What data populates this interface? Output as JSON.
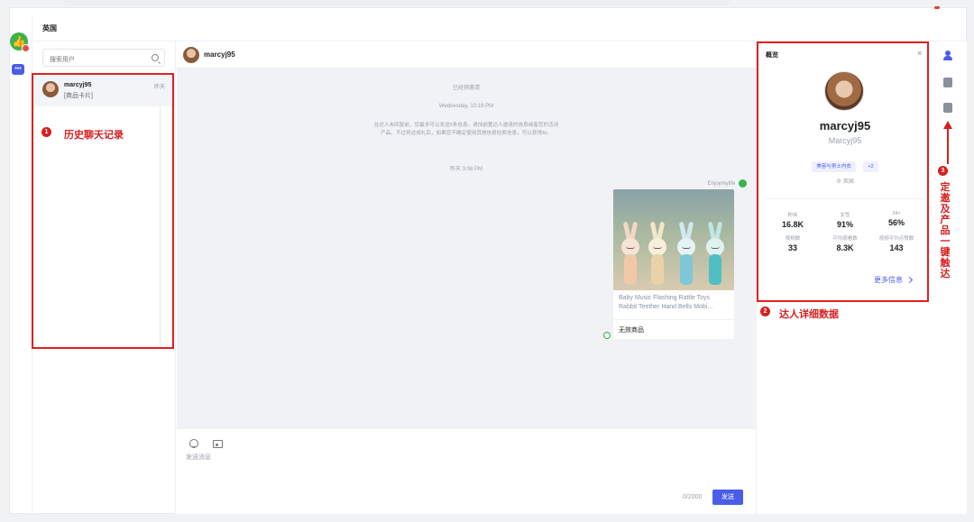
{
  "header": {
    "title": "英国"
  },
  "search": {
    "placeholder": "搜索用户"
  },
  "conversations": [
    {
      "name": "marcyj95",
      "preview": "[商品卡片]",
      "time": "昨天"
    }
  ],
  "chat": {
    "contact_name": "marcyj95",
    "system_messages": {
      "invited": "已经预邀请",
      "date1": "Wednesday, 10:18 PM",
      "notice": "在达人未回复前，您最多可以发送5条信息。请加前置达人邀请的信息或者您的活动产品。不过将达成礼后，如果您不确定使用其他信息检索信息，可以获得AI。",
      "date2": "昨天 3:08 PM"
    },
    "sender_name": "Enjoymylife",
    "product": {
      "title": "Baby Music Flashing Rattle Toys Rabbit Teether Hand Bells Mobi...",
      "subtitle": "无效商品"
    },
    "composer": {
      "placeholder": "发送消息",
      "counter": "0/2000",
      "send_label": "发送"
    }
  },
  "profile": {
    "title": "概览",
    "close": "×",
    "name": "marcyj95",
    "handle": "Marcyj95",
    "tags": [
      "美容与男士内衣",
      "+2"
    ],
    "region": "英国",
    "stats": [
      {
        "label": "粉丝",
        "value": "16.8K"
      },
      {
        "label": "女性",
        "value": "91%"
      },
      {
        "label": "34+",
        "value": "56%"
      },
      {
        "label": "视频数",
        "value": "33"
      },
      {
        "label": "平均观看数",
        "value": "8.3K"
      },
      {
        "label": "视频平均点赞数",
        "value": "143"
      }
    ],
    "more_label": "更多信息"
  },
  "annotations": {
    "one": {
      "num": "1",
      "text": "历史聊天记录"
    },
    "two": {
      "num": "2",
      "text": "达人详细数据"
    },
    "three": {
      "num": "3",
      "text": "定邀及产品一键触达"
    }
  },
  "colors": {
    "accent": "#4b5de8",
    "annotation_red": "#d81e1e",
    "brand_green": "#3bb34a",
    "chat_bg": "#f1f2f6"
  },
  "icons": {
    "rail": [
      "app-logo-icon",
      "chat-icon"
    ],
    "right_rail": [
      "person-icon",
      "box-icon",
      "doc-icon"
    ]
  }
}
